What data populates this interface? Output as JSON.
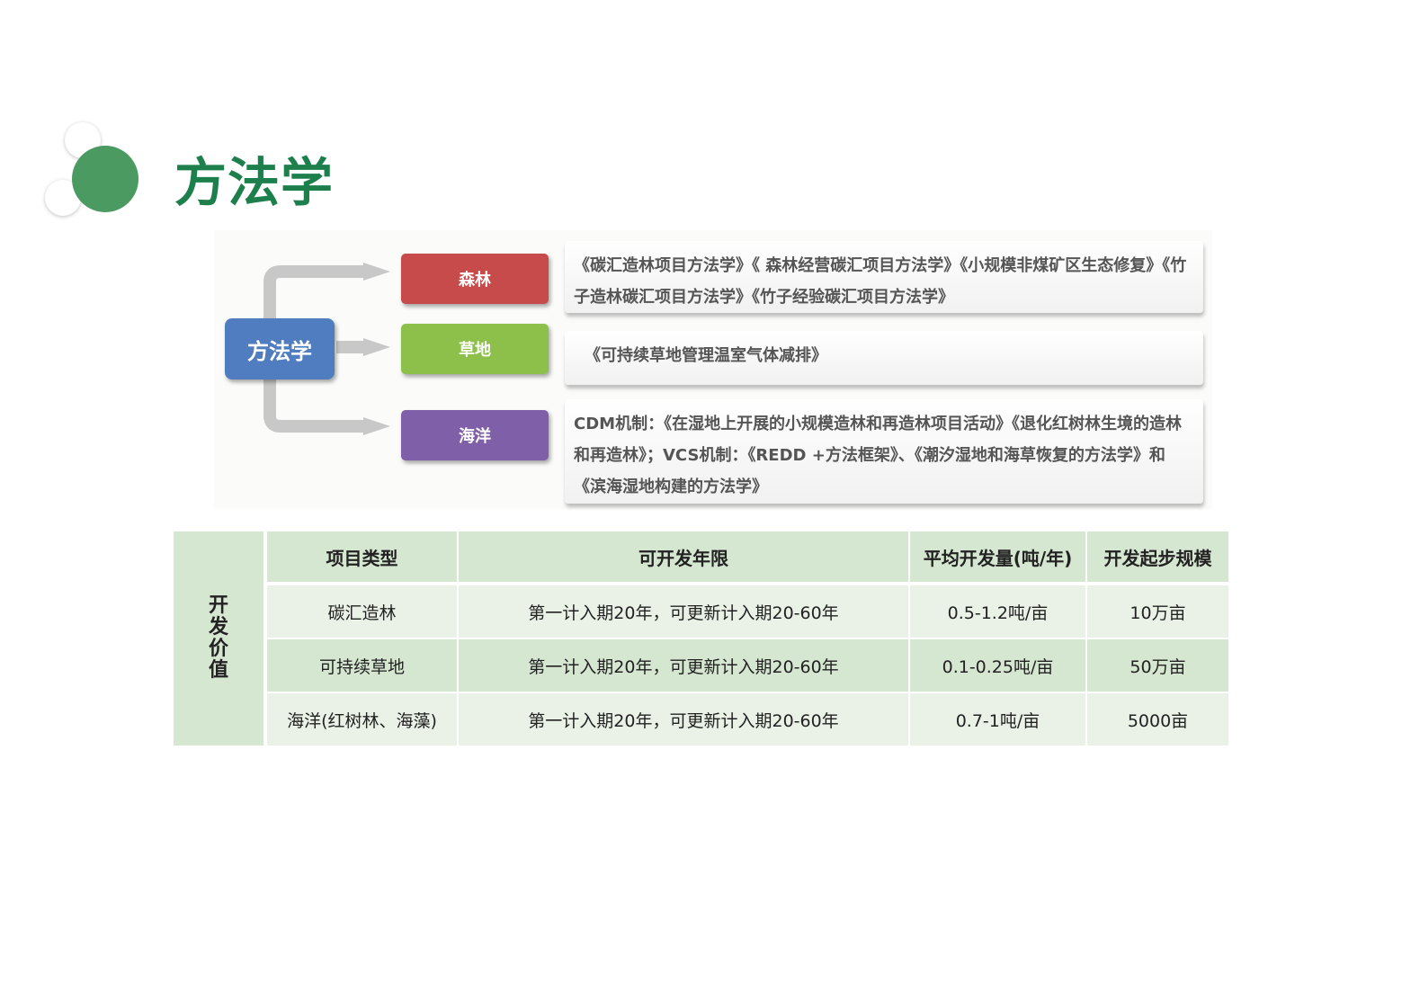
{
  "title": "方法学",
  "diagram": {
    "root": "方法学",
    "branches": [
      {
        "label": "森林",
        "color": "#c84b4b",
        "description": "《碳汇造林项目方法学》《 森林经营碳汇项目方法学》《小规模非煤矿区生态修复》《竹子造林碳汇项目方法学》《竹子经验碳汇项目方法学》"
      },
      {
        "label": "草地",
        "color": "#8dc04b",
        "description": "《可持续草地管理温室气体减排》"
      },
      {
        "label": "海洋",
        "color": "#7f5fa8",
        "description": "CDM机制：《在湿地上开展的小规模造林和再造林项目活动》《退化红树林生境的造林和再造林》；VCS机制：《REDD +方法框架》、《潮汐湿地和海草恢复的方法学》和《滨海湿地构建的方法学》"
      }
    ]
  },
  "table": {
    "side_label": "开发价值",
    "headers": [
      "项目类型",
      "可开发年限",
      "平均开发量(吨/年)",
      "开发起步规模"
    ],
    "rows": [
      [
        "碳汇造林",
        "第一计入期20年，可更新计入期20-60年",
        "0.5-1.2吨/亩",
        "10万亩"
      ],
      [
        "可持续草地",
        "第一计入期20年，可更新计入期20-60年",
        "0.1-0.25吨/亩",
        "50万亩"
      ],
      [
        "海洋(红树林、海藻)",
        "第一计入期20年，可更新计入期20-60年",
        "0.7-1吨/亩",
        "5000亩"
      ]
    ]
  },
  "colors": {
    "accent_green": "#1d7f4c",
    "root_blue": "#4f7dbf",
    "table_header": "#d5e6d1",
    "table_row_light": "#eaf1e7"
  }
}
